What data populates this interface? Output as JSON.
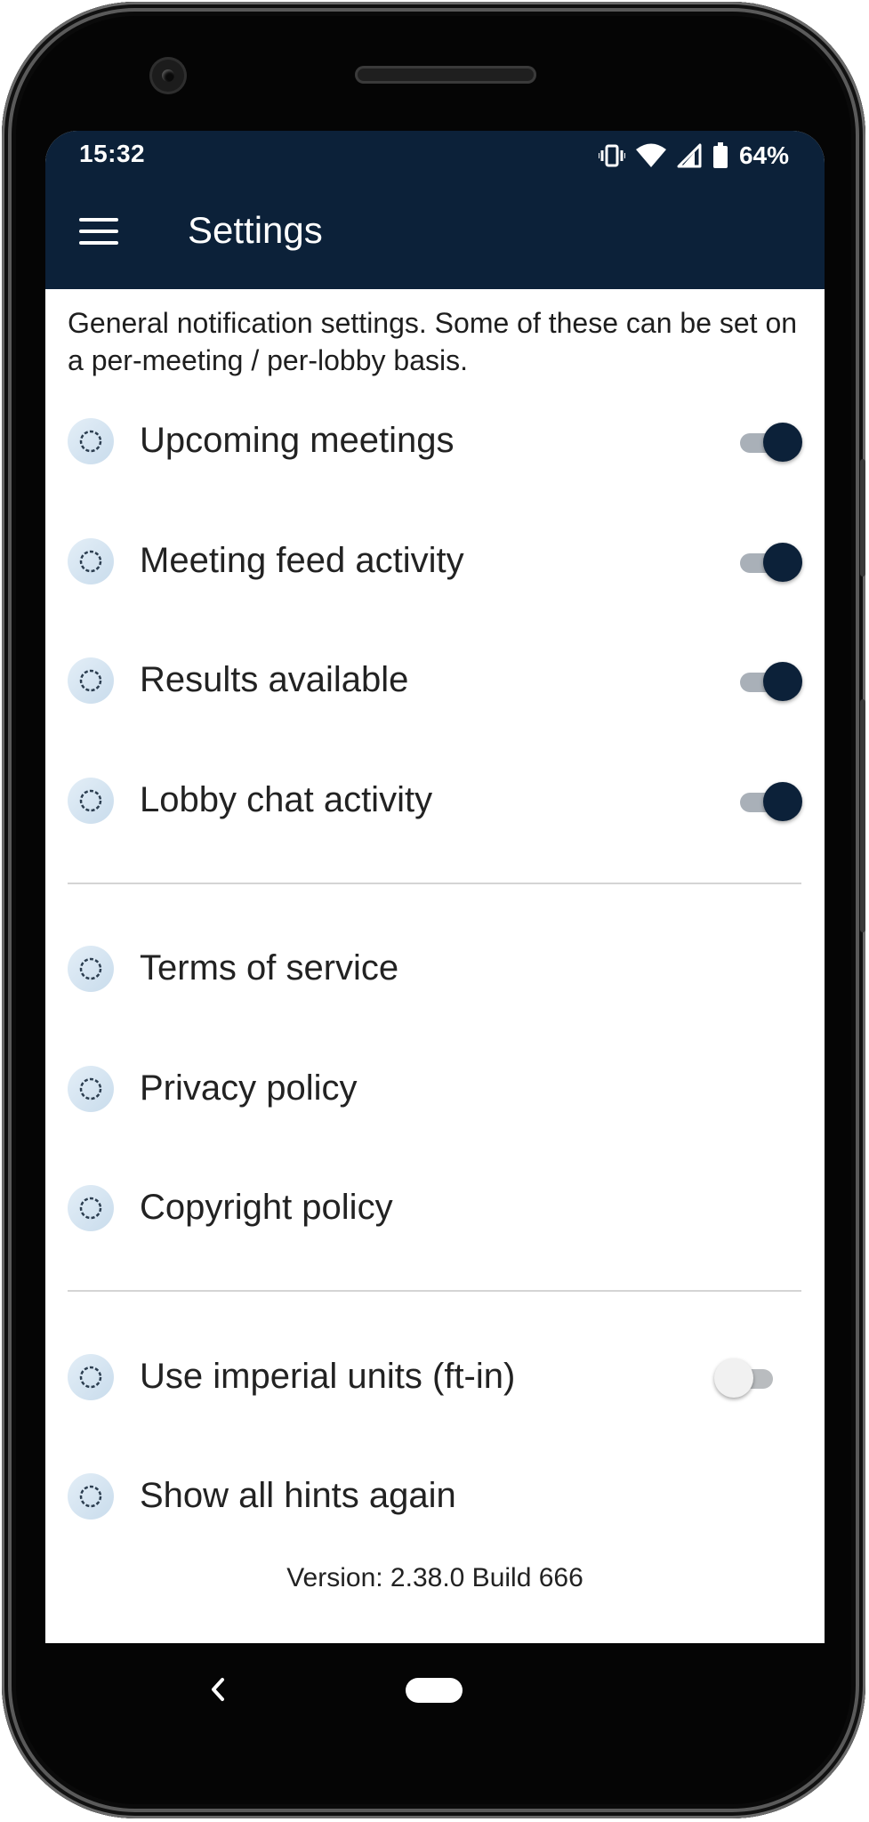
{
  "status_bar": {
    "time": "15:32",
    "battery_percent": "64%",
    "icons": [
      "vibrate-icon",
      "wifi-icon",
      "signal-icon",
      "battery-icon"
    ]
  },
  "app_bar": {
    "title": "Settings",
    "menu_icon": "hamburger-menu-icon"
  },
  "intro": "General notification settings. Some of these can be set on a per-meeting / per-lobby basis.",
  "notification_settings": [
    {
      "label": "Upcoming meetings",
      "enabled": true
    },
    {
      "label": "Meeting feed activity",
      "enabled": true
    },
    {
      "label": "Results available",
      "enabled": true
    },
    {
      "label": "Lobby chat activity",
      "enabled": true
    }
  ],
  "policy_links": [
    {
      "label": "Terms of service"
    },
    {
      "label": "Privacy policy"
    },
    {
      "label": "Copyright policy"
    }
  ],
  "preferences": [
    {
      "label": "Use imperial units (ft-in)",
      "enabled": false
    },
    {
      "label": "Show all hints again"
    }
  ],
  "row_icon": "settings-gear-icon",
  "version": "Version: 2.38.0 Build 666",
  "nav_bar": {
    "back_icon": "back-chevron-icon",
    "home_icon": "home-pill-icon"
  },
  "colors": {
    "app_bar": "#0c2139",
    "toggle_on": "#0c2139",
    "text": "#222222",
    "divider": "#d4d4d4"
  }
}
